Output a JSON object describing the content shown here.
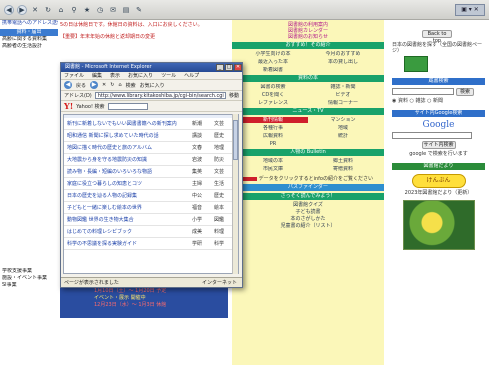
{
  "window_controls": {
    "right": "▣ ▾ ✕"
  },
  "left_col": {
    "top_link": "携帯電話へのアドレス送信",
    "head1": "資料・届出",
    "items": [
      "高齢に関する資料集",
      "高齢者の生活設計"
    ],
    "bottom_items": [
      "学校支援事業",
      "施設・イベント事業",
      "Sl事業"
    ]
  },
  "notice": {
    "line1": "5の日は休館日です。休館日の資料は、入口にお戻しください。",
    "line2": "【重要】年末年始の休館と返却期日の変更"
  },
  "mid": {
    "top_links": [
      "図書館の利用案内",
      "図書館カレンダー",
      "図書館のお知らせ"
    ],
    "head1": "おすすめ！その紹介",
    "grid1": [
      "小学生向けの本",
      "今月のおすすめ",
      "最近入った本",
      "本の貸し出し",
      "新着図書",
      ""
    ],
    "head2": "資料の本",
    "grid2": [
      "図書の検索",
      "雑誌・新聞",
      "CDを聞く",
      "ビデオ",
      "レファレンス",
      "情報コーナー"
    ],
    "head3": "ニュース・TV",
    "grid3": [
      "新刊情報",
      "マンション",
      "各種行事",
      "地域",
      "広報資料",
      "統計",
      "PR",
      ""
    ],
    "head4": "人物の Bulletin",
    "grid4": [
      "地域の本",
      "郷土資料",
      "市民文庫",
      "寄贈資料"
    ],
    "info_line": "データをクリックするとinfoの紹介をご覧ください",
    "head5": "パスファインダー",
    "head6": "さっそく読んでみよう！",
    "list": [
      "図書館クイズ",
      "子ども読書",
      "本のさがしかた",
      "児童書の紹介（リスト）"
    ]
  },
  "right_col": {
    "btn_top": "Back to top",
    "text1": "日本の図書館を探す（全国の図書館ページ）",
    "head1": "蔵書検索",
    "search_btn": "検索",
    "opts": "◉ 資料  ○ 雑誌  ○ 新聞",
    "head2": "サイト内Google検索",
    "google": "Google",
    "gsearch_btn": "サイト内検索",
    "text2": "google で検索を行います",
    "head3": "図書館だより",
    "icon_text": "けんぶん",
    "caption": "2023年図書館だより（更新）"
  },
  "event": {
    "line1": "1月10日（土）〜 1月20日 予定",
    "line2": "イベント・展示 開催中",
    "line3": "12月23日（水）〜 1月3日 休館"
  },
  "popup": {
    "title": "図書館 - Microsoft Internet Explorer",
    "menu": [
      "ファイル",
      "編集",
      "表示",
      "お気に入り",
      "ツール",
      "ヘルプ"
    ],
    "toolbar": [
      "戻る",
      "進む",
      "中止",
      "更新",
      "ホーム",
      "検索",
      "お気に入り"
    ],
    "addr_label": "アドレス(D)",
    "addr_value": "http://www.library.kitakoshiba.jp/cgi-bin/search.cgi",
    "go_label": "移動",
    "ylogo": "Y!",
    "ylabel": "Yahoo! 検索",
    "rows": [
      {
        "title": "新刊に新着しないでもいい図書書籍への新刊案内",
        "pub": "新潮",
        "cat": "文芸"
      },
      {
        "title": "昭和通信 新聞に探し求めていた時代の話",
        "pub": "講談",
        "cat": "歴史"
      },
      {
        "title": "地図に描く時代の歴史と旅のアルバム",
        "pub": "文春",
        "cat": "地理"
      },
      {
        "title": "大地震から身を守る地震防災の知識",
        "pub": "岩波",
        "cat": "防災"
      },
      {
        "title": "読み物・長編・短編のいろいろな物語",
        "pub": "集英",
        "cat": "文芸"
      },
      {
        "title": "家庭に役立つ暮らしの知恵とコツ",
        "pub": "主婦",
        "cat": "生活"
      },
      {
        "title": "日本の歴史を辿る人物の記録集",
        "pub": "中公",
        "cat": "歴史"
      },
      {
        "title": "子どもと一緒に楽しむ絵本の世界",
        "pub": "福音",
        "cat": "絵本"
      },
      {
        "title": "動物図鑑 世界の生き物大集合",
        "pub": "小学",
        "cat": "図鑑"
      },
      {
        "title": "はじめての料理レシピブック",
        "pub": "成美",
        "cat": "料理"
      },
      {
        "title": "科学の不思議を探る実験ガイド",
        "pub": "学研",
        "cat": "科学"
      }
    ],
    "status": "ページが表示されました",
    "zone": "インターネット"
  }
}
